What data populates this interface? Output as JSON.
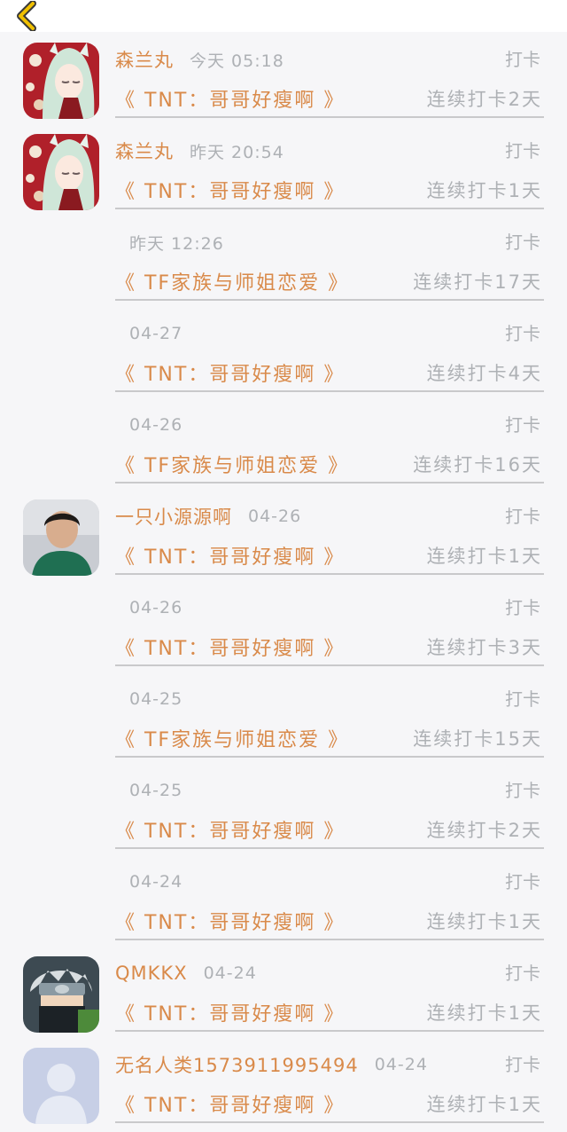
{
  "header": {
    "back_icon": "chevron-left-icon",
    "accent": "#f0c000"
  },
  "colors": {
    "accent_text": "#d98a4a",
    "muted_text": "#aeb1b5",
    "background": "#f6f6f8"
  },
  "records": [
    {
      "avatar": "anime-girl",
      "name": "森兰丸",
      "time": "今天 05:18",
      "action": "打卡",
      "book": "《 TNT：哥哥好瘦啊 》",
      "streak": "连续打卡2天"
    },
    {
      "avatar": "anime-girl",
      "name": "森兰丸",
      "time": "昨天 20:54",
      "action": "打卡",
      "book": "《 TNT：哥哥好瘦啊 》",
      "streak": "连续打卡1天"
    },
    {
      "avatar": "",
      "name": "",
      "time": "昨天 12:26",
      "action": "打卡",
      "book": "《 TF家族与师姐恋爱 》",
      "streak": "连续打卡17天"
    },
    {
      "avatar": "",
      "name": "",
      "time": "04-27",
      "action": "打卡",
      "book": "《 TNT：哥哥好瘦啊 》",
      "streak": "连续打卡4天"
    },
    {
      "avatar": "",
      "name": "",
      "time": "04-26",
      "action": "打卡",
      "book": "《 TF家族与师姐恋爱 》",
      "streak": "连续打卡16天"
    },
    {
      "avatar": "boy-photo",
      "name": "一只小源源啊",
      "time": "04-26",
      "action": "打卡",
      "book": "《 TNT：哥哥好瘦啊 》",
      "streak": "连续打卡1天"
    },
    {
      "avatar": "",
      "name": "",
      "time": "04-26",
      "action": "打卡",
      "book": "《 TNT：哥哥好瘦啊 》",
      "streak": "连续打卡3天"
    },
    {
      "avatar": "",
      "name": "",
      "time": "04-25",
      "action": "打卡",
      "book": "《 TF家族与师姐恋爱 》",
      "streak": "连续打卡15天"
    },
    {
      "avatar": "",
      "name": "",
      "time": "04-25",
      "action": "打卡",
      "book": "《 TNT：哥哥好瘦啊 》",
      "streak": "连续打卡2天"
    },
    {
      "avatar": "",
      "name": "",
      "time": "04-24",
      "action": "打卡",
      "book": "《 TNT：哥哥好瘦啊 》",
      "streak": "连续打卡1天"
    },
    {
      "avatar": "ninja",
      "name": "QMKKX",
      "time": "04-24",
      "action": "打卡",
      "book": "《 TNT：哥哥好瘦啊 》",
      "streak": "连续打卡1天"
    },
    {
      "avatar": "default-user",
      "name": "无名人类1573911995494",
      "time": "04-24",
      "action": "打卡",
      "book": "《 TNT：哥哥好瘦啊 》",
      "streak": "连续打卡1天"
    }
  ]
}
